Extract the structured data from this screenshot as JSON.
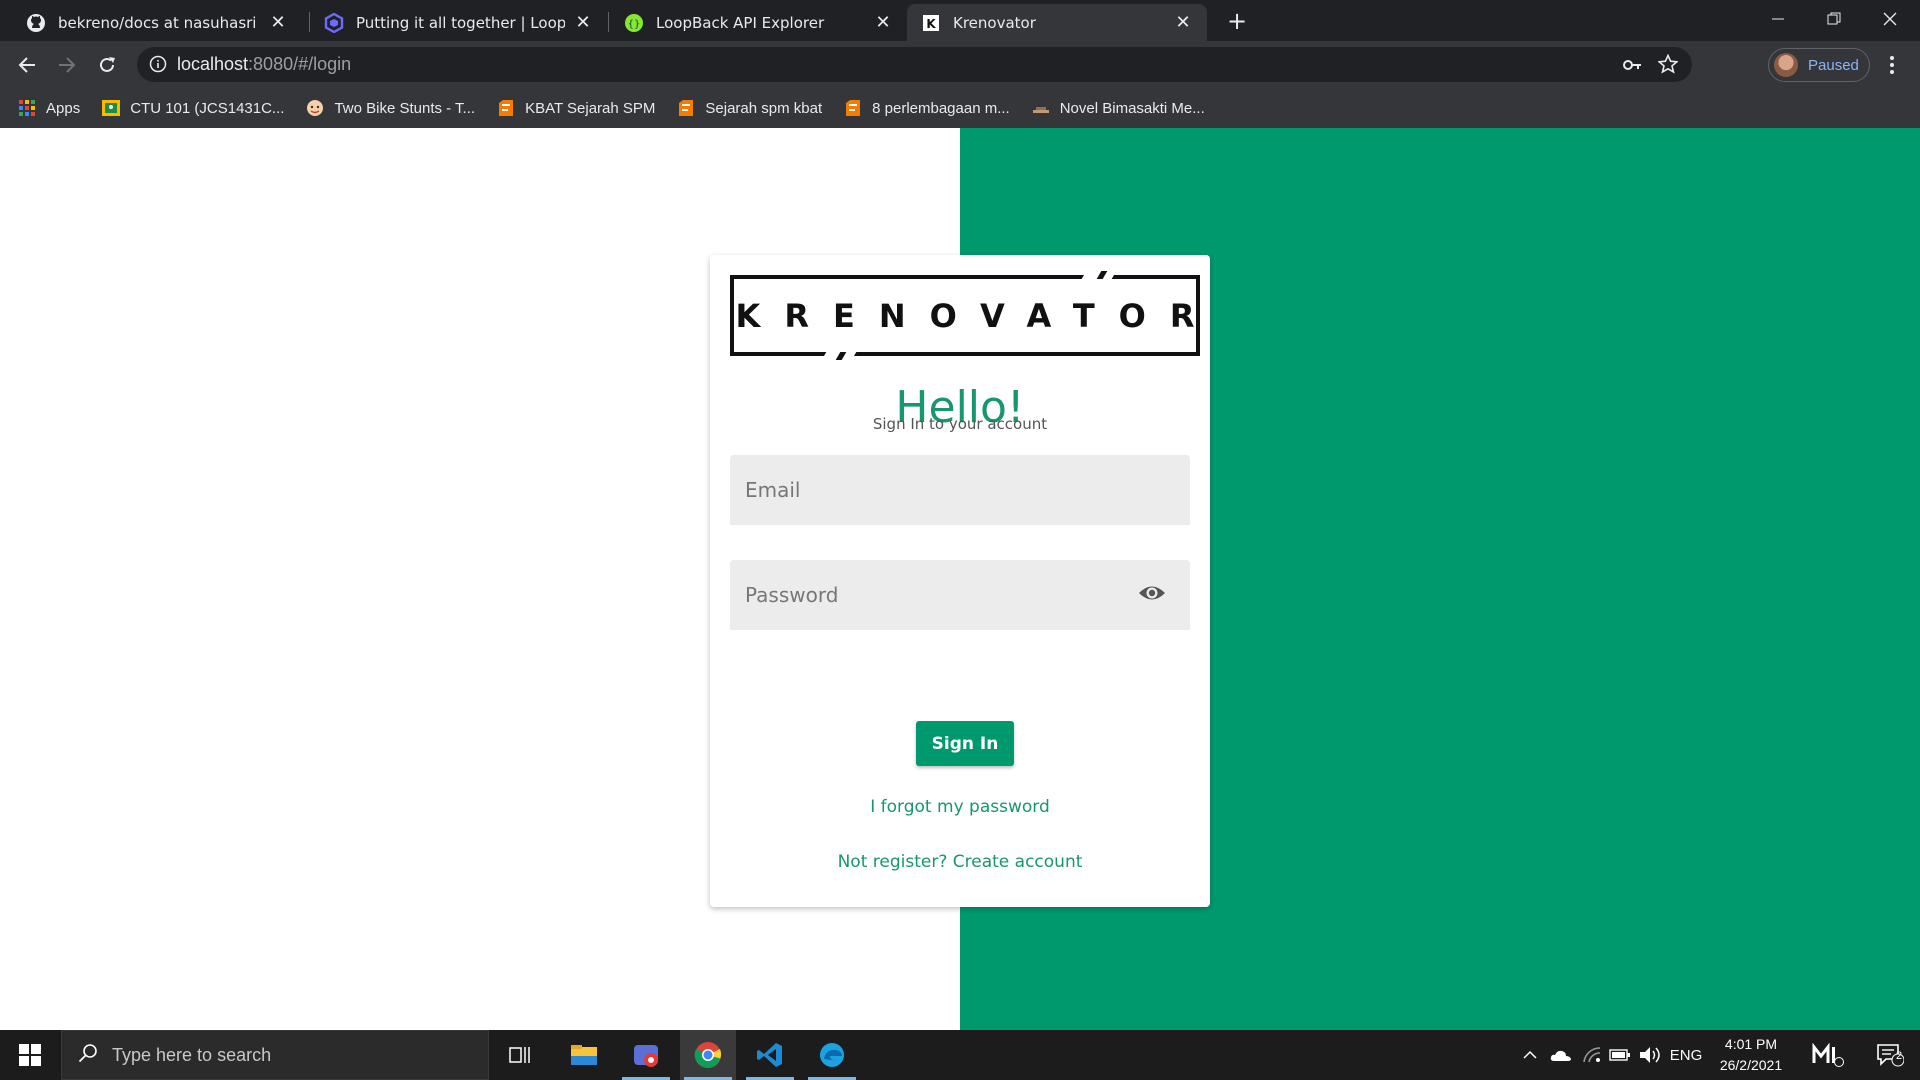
{
  "browser": {
    "tabs": [
      {
        "title": "bekreno/docs at nasuhasri · nasuhasri",
        "favicon": "github-icon",
        "active": false
      },
      {
        "title": "Putting it all together | LoopBack",
        "favicon": "loopback-icon",
        "active": false
      },
      {
        "title": "LoopBack API Explorer",
        "favicon": "swagger-icon",
        "active": false
      },
      {
        "title": "Krenovator",
        "favicon": "krenovator-icon",
        "active": true
      }
    ],
    "close_glyph": "✕",
    "new_tab_glyph": "+",
    "address": {
      "host": "localhost",
      "rest": ":8080/#/login"
    },
    "profile_label": "Paused"
  },
  "bookmarks": [
    {
      "label": "Apps",
      "icon": "apps-grid-icon"
    },
    {
      "label": "CTU 101 (JCS1431C...",
      "icon": "classroom-icon"
    },
    {
      "label": "Two Bike Stunts - T...",
      "icon": "emoji-icon"
    },
    {
      "label": "KBAT Sejarah SPM",
      "icon": "blogger-icon"
    },
    {
      "label": "Sejarah spm kbat",
      "icon": "blogger-icon"
    },
    {
      "label": "8 perlembagaan m...",
      "icon": "blogger-icon"
    },
    {
      "label": "Novel Bimasakti Me...",
      "icon": "book-icon"
    }
  ],
  "login": {
    "logo_text": "KRENOVATOR",
    "heading": "Hello!",
    "subtitle": "Sign In to your account",
    "email_placeholder": "Email",
    "password_placeholder": "Password",
    "signin_label": "Sign In",
    "forgot_link": "I forgot my password",
    "register_link": "Not register? Create account"
  },
  "colors": {
    "brand_green": "#00996e",
    "text_green": "#17976f"
  },
  "taskbar": {
    "search_placeholder": "Type here to search",
    "apps": [
      "task-view-icon",
      "file-explorer-icon",
      "photos-app-icon",
      "chrome-icon",
      "vscode-icon",
      "edge-icon"
    ],
    "language": "ENG",
    "time": "4:01 PM",
    "date": "26/2/2021",
    "notification_count": "2"
  }
}
